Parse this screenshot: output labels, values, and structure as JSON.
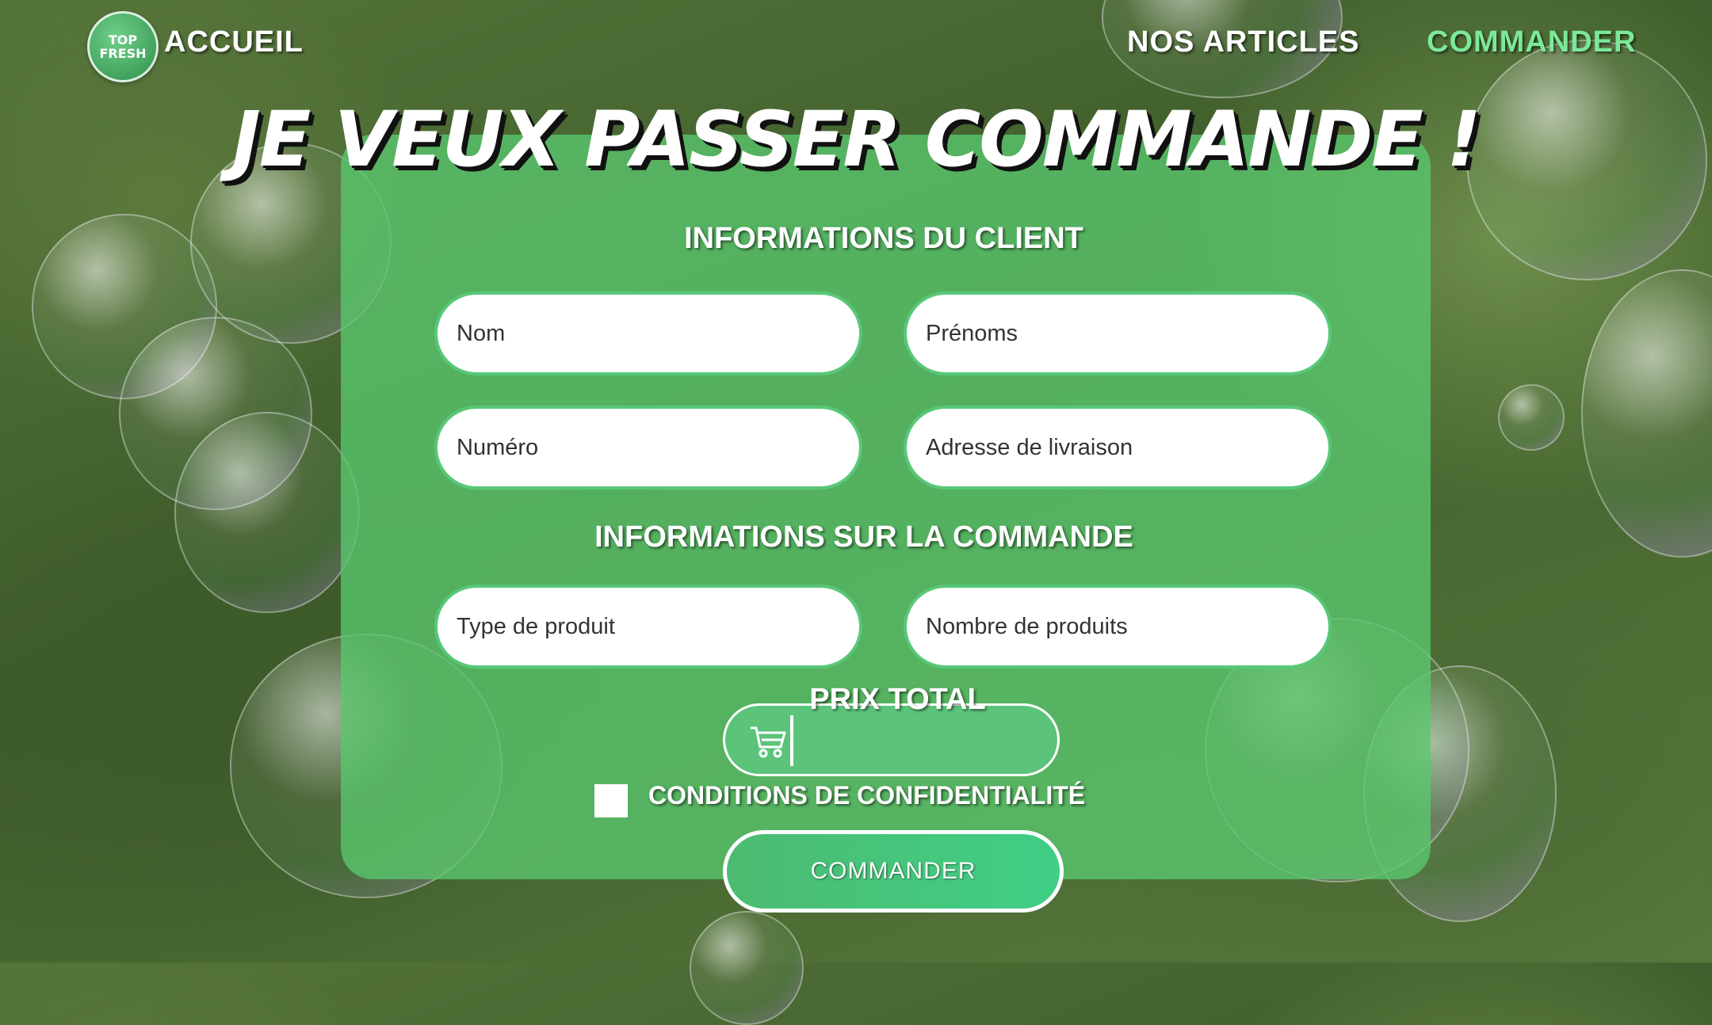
{
  "nav": {
    "logo_text_line1": "TOP",
    "logo_text_line2": "FRESH",
    "home_label": "ACCUEIL",
    "articles_label": "NOS ARTICLES",
    "order_label": "COMMANDER"
  },
  "colors": {
    "panel": "#5ac86e",
    "active_nav": "#7be89a",
    "button": "#4dbb72"
  },
  "page": {
    "title": "JE VEUX PASSER COMMANDE !"
  },
  "client_section": {
    "title": "INFORMATIONS DU CLIENT",
    "name_placeholder": "Nom",
    "firstname_placeholder": "Prénoms",
    "phone_placeholder": "Numéro",
    "address_placeholder": "Adresse de livraison"
  },
  "order_section": {
    "title": "INFORMATIONS SUR LA COMMANDE",
    "product_type_placeholder": "Type de produit",
    "quantity_placeholder": "Nombre de produits"
  },
  "total": {
    "label": "PRIX TOTAL",
    "icon": "cart-icon"
  },
  "consent": {
    "label": "CONDITIONS DE CONFIDENTIALITÉ",
    "checked": false
  },
  "submit": {
    "label": "COMMANDER"
  }
}
